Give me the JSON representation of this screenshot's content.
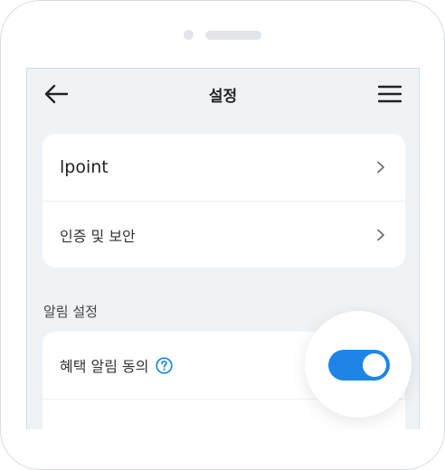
{
  "header": {
    "title": "설정",
    "back_icon": "arrow-left-icon",
    "menu_icon": "hamburger-menu-icon"
  },
  "account_card": {
    "items": [
      {
        "label": "lpoint",
        "icon": "chevron-right-icon"
      },
      {
        "label": "인증 및 보안",
        "icon": "chevron-right-icon"
      }
    ]
  },
  "notification_section": {
    "title": "알림 설정",
    "items": [
      {
        "label": "혜택 알림 동의",
        "help_icon": "question-circle-icon",
        "toggle_on": true
      }
    ]
  },
  "colors": {
    "accent": "#1e85e6",
    "screen_bg": "#f0f3f6",
    "card_bg": "#ffffff"
  }
}
